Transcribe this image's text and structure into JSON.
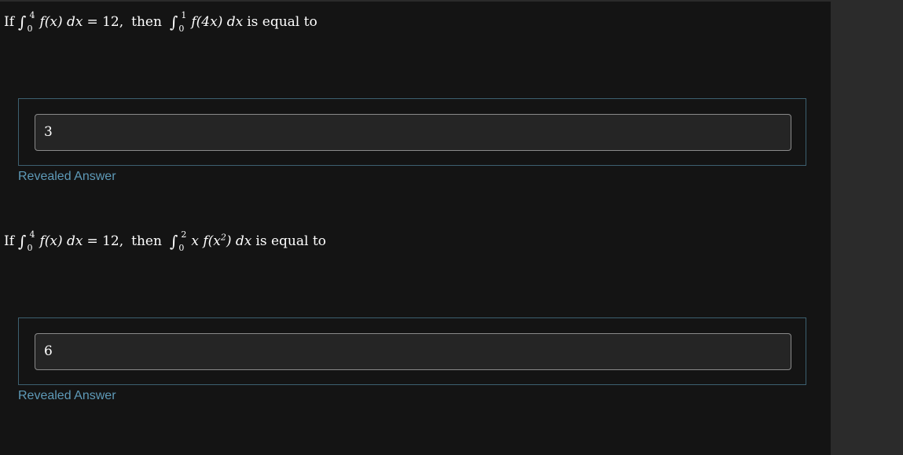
{
  "questions": [
    {
      "prompt": {
        "if": "If",
        "int1": {
          "upper": "4",
          "lower": "0",
          "integrand": "f(x) dx"
        },
        "equals": "= 12,",
        "then": "then",
        "int2": {
          "upper": "1",
          "lower": "0",
          "integrand": "f(4x) dx"
        },
        "suffix": "is equal to"
      },
      "answer_value": "3",
      "revealed_label": "Revealed Answer"
    },
    {
      "prompt": {
        "if": "If",
        "int1": {
          "upper": "4",
          "lower": "0",
          "integrand": "f(x) dx"
        },
        "equals": "= 12,",
        "then": "then",
        "int2": {
          "upper": "2",
          "lower": "0",
          "integrand_pre": "x f(x",
          "integrand_sup": "2",
          "integrand_post": ") dx"
        },
        "suffix": "is equal to"
      },
      "answer_value": "6",
      "revealed_label": "Revealed Answer"
    }
  ],
  "colors": {
    "page_background": "#141414",
    "side_background": "#2b2b2b",
    "answer_border": "#3d6070",
    "revealed_text": "#5e9ab8",
    "input_border": "#8a8a8a"
  }
}
